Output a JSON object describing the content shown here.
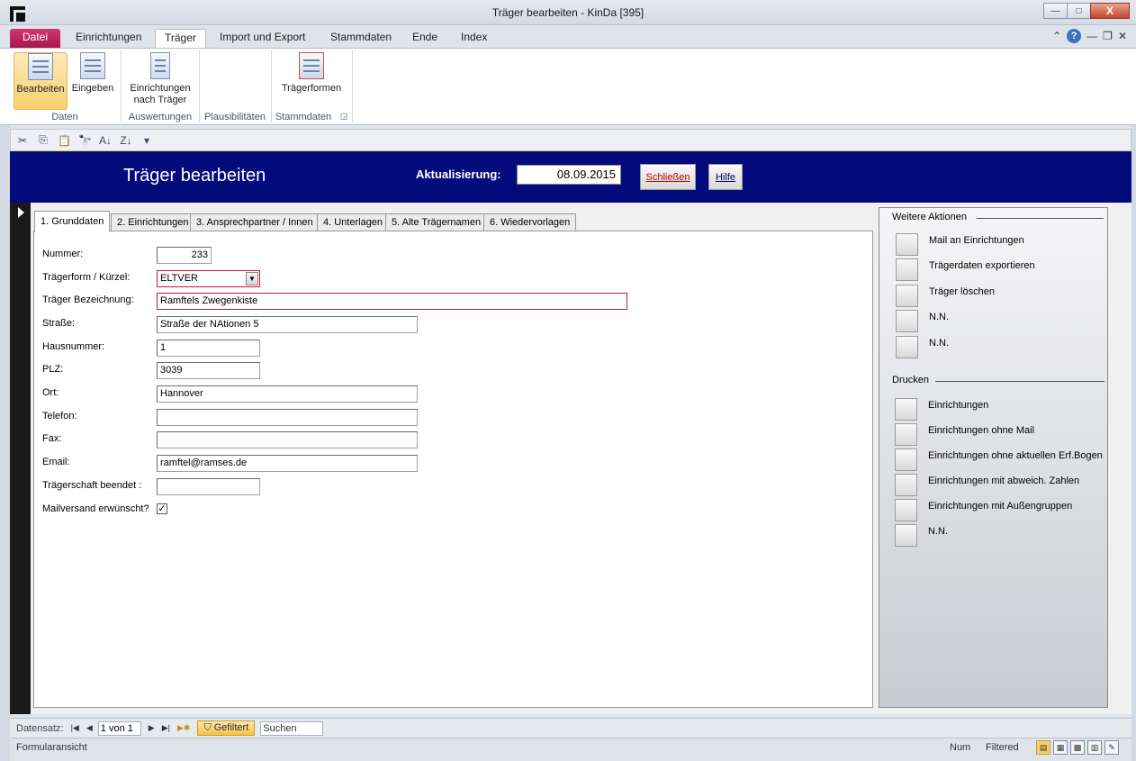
{
  "window": {
    "title": "Träger bearbeiten  -  KinDa [395]",
    "minimize": "—",
    "maximize": "□",
    "close": "X"
  },
  "ribbon_tabs": [
    "Datei",
    "Einrichtungen",
    "Träger",
    "Import und Export",
    "Stammdaten",
    "Ende",
    "Index"
  ],
  "tabsbar_icons": {
    "up": "⌃",
    "help": "?",
    "min": "—",
    "restore": "❐",
    "close": "✕"
  },
  "ribbon": {
    "bearbeiten": "Bearbeiten",
    "eingeben": "Eingeben",
    "einrichtungen_line1": "Einrichtungen",
    "einrichtungen_line2": "nach Träger",
    "traegerformen": "Trägerformen",
    "groups": {
      "daten": "Daten",
      "auswertungen": "Auswertungen",
      "plausibilitaeten": "Plausibilitäten",
      "stammdaten": "Stammdaten"
    },
    "stammdaten_launcher": "◲"
  },
  "qat_icons": [
    "✂",
    "⎘",
    "📋",
    "🔭",
    "A↓",
    "Z↓",
    "▾"
  ],
  "header": {
    "title": "Träger bearbeiten",
    "update_label": "Aktualisierung:",
    "update_date": "08.09.2015",
    "close_button": "Schließen",
    "help_button": "Hilfe"
  },
  "form_tabs": [
    "1. Grunddaten",
    "2. Einrichtungen",
    "3. Ansprechpartner / Innen",
    "4. Unterlagen",
    "5. Alte Trägernamen",
    "6. Wiedervorlagen"
  ],
  "fields": {
    "nummer": {
      "label": "Nummer:",
      "value": "233"
    },
    "traegerform": {
      "label": "Trägerform / Kürzel:",
      "value": "ELTVER"
    },
    "bezeichnung": {
      "label": "Träger Bezeichnung:",
      "value": "Ramftels Zwegenkiste"
    },
    "strasse": {
      "label": "Straße:",
      "value": "Straße der NAtionen 5"
    },
    "hausnummer": {
      "label": "Hausnummer:",
      "value": "1"
    },
    "plz": {
      "label": "PLZ:",
      "value": "3039"
    },
    "ort": {
      "label": "Ort:",
      "value": "Hannover"
    },
    "telefon": {
      "label": "Telefon:",
      "value": ""
    },
    "fax": {
      "label": "Fax:",
      "value": ""
    },
    "email": {
      "label": "Email:",
      "value": "ramftel@ramses.de"
    },
    "beendet": {
      "label": "Trägerschaft beendet :",
      "value": ""
    },
    "mailversand": {
      "label": "Mailversand erwünscht?",
      "checked": "✓"
    }
  },
  "right_panel": {
    "actions_title": "Weitere Aktionen",
    "actions": [
      "Mail an Einrichtungen",
      "Trägerdaten exportieren",
      "Träger löschen",
      "N.N.",
      "N.N."
    ],
    "print_title": "Drucken",
    "print": [
      "Einrichtungen",
      "Einrichtungen ohne Mail",
      "Einrichtungen ohne aktuellen Erf.Bogen",
      "Einrichtungen mit abweich. Zahlen",
      "Einrichtungen mit Außengruppen",
      "N.N."
    ]
  },
  "navbar": {
    "label": "Datensatz:",
    "first": "|◀",
    "prev": "◀",
    "position": "1 von 1",
    "next": "▶",
    "last": "▶|",
    "new": "▶✱",
    "filter": "Gefiltert",
    "filter_icon": "⛉",
    "search": "Suchen"
  },
  "statusbar": {
    "view": "Formularansicht",
    "num": "Num",
    "filtered": "Filtered",
    "view_icons": [
      "▤",
      "▦",
      "▩",
      "▥",
      "✎"
    ]
  }
}
